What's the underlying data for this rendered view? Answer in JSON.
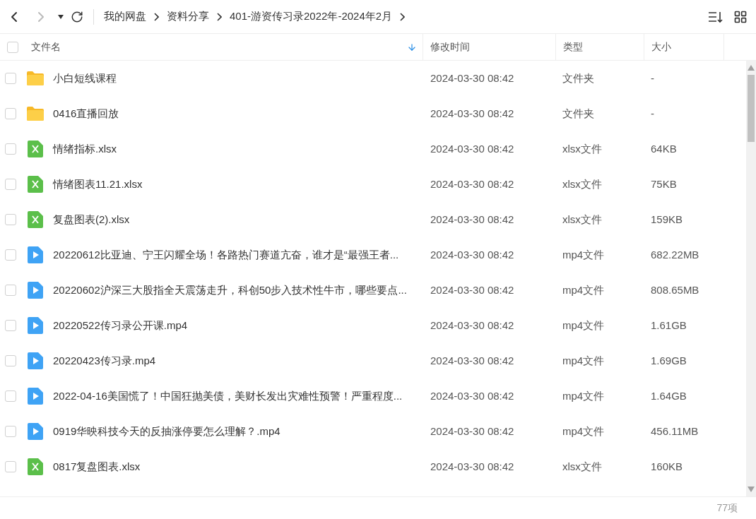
{
  "breadcrumb": [
    "我的网盘",
    "资料分享",
    "401-游资传习录2022年-2024年2月"
  ],
  "columns": [
    {
      "label": "文件名",
      "sorted": true
    },
    {
      "label": "修改时间",
      "sorted": false
    },
    {
      "label": "类型",
      "sorted": false
    },
    {
      "label": "大小",
      "sorted": false
    }
  ],
  "select_all": {
    "checked": false
  },
  "files": [
    {
      "kind": "folder",
      "name": "小白短线课程",
      "modified": "2024-03-30 08:42",
      "type": "文件夹",
      "size": "-",
      "checked": false
    },
    {
      "kind": "folder",
      "name": "0416直播回放",
      "modified": "2024-03-30 08:42",
      "type": "文件夹",
      "size": "-",
      "checked": false
    },
    {
      "kind": "xlsx",
      "name": "情绪指标.xlsx",
      "modified": "2024-03-30 08:42",
      "type": "xlsx文件",
      "size": "64KB",
      "checked": false
    },
    {
      "kind": "xlsx",
      "name": "情绪图表11.21.xlsx",
      "modified": "2024-03-30 08:42",
      "type": "xlsx文件",
      "size": "75KB",
      "checked": false
    },
    {
      "kind": "xlsx",
      "name": "复盘图表(2).xlsx",
      "modified": "2024-03-30 08:42",
      "type": "xlsx文件",
      "size": "159KB",
      "checked": false
    },
    {
      "kind": "video",
      "name": "20220612比亚迪、宁王闪耀全场！各路热门赛道亢奋，谁才是“最强王者...",
      "modified": "2024-03-30 08:42",
      "type": "mp4文件",
      "size": "682.22MB",
      "checked": false
    },
    {
      "kind": "video",
      "name": "20220602沪深三大股指全天震荡走升，科创50步入技术性牛市，哪些要点...",
      "modified": "2024-03-30 08:42",
      "type": "mp4文件",
      "size": "808.65MB",
      "checked": false
    },
    {
      "kind": "video",
      "name": "20220522传习录公开课.mp4",
      "modified": "2024-03-30 08:42",
      "type": "mp4文件",
      "size": "1.61GB",
      "checked": false
    },
    {
      "kind": "video",
      "name": "20220423传习录.mp4",
      "modified": "2024-03-30 08:42",
      "type": "mp4文件",
      "size": "1.69GB",
      "checked": false
    },
    {
      "kind": "video",
      "name": "2022-04-16美国慌了！中国狂抛美债，美财长发出灾难性预警！严重程度...",
      "modified": "2024-03-30 08:42",
      "type": "mp4文件",
      "size": "1.64GB",
      "checked": false
    },
    {
      "kind": "video",
      "name": "0919华映科技今天的反抽涨停要怎么理解？.mp4",
      "modified": "2024-03-30 08:42",
      "type": "mp4文件",
      "size": "456.11MB",
      "checked": false
    },
    {
      "kind": "xlsx",
      "name": "0817复盘图表.xlsx",
      "modified": "2024-03-30 08:42",
      "type": "xlsx文件",
      "size": "160KB",
      "checked": false
    }
  ],
  "item_count": "77项"
}
